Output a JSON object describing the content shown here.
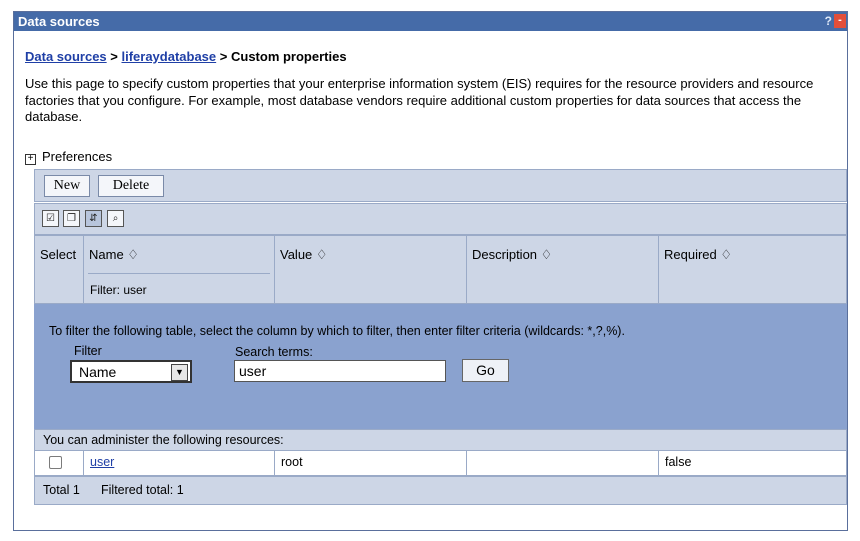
{
  "window": {
    "title": "Data sources",
    "help": "?",
    "minimize": "-"
  },
  "breadcrumb": {
    "root": "Data sources",
    "sep1": " > ",
    "db": "liferaydatabase",
    "sep2": " > ",
    "current": "Custom properties"
  },
  "intro": "Use this page to specify custom properties that your enterprise information system (EIS) requires for the resource providers and resource factories that you configure. For example, most database vendors require additional custom properties for data sources that access the database.",
  "preferences": {
    "expander": "+",
    "label": "Preferences"
  },
  "toolbar": {
    "new_label": "New",
    "delete_label": "Delete"
  },
  "icons": [
    "select-all-icon",
    "deselect-all-icon",
    "show-filter-icon",
    "clear-filter-icon"
  ],
  "table": {
    "columns": {
      "select": "Select",
      "name": "Name ♢",
      "value": "Value ♢",
      "description": "Description ♢",
      "required": "Required ♢"
    },
    "filter_hint": "Filter: user"
  },
  "filter": {
    "instruction": "To filter the following table, select the column by which to filter, then enter filter criteria (wildcards: *,?,%).",
    "filter_label": "Filter",
    "selected_column": "Name",
    "search_label": "Search terms:",
    "search_value": "user",
    "go_label": "Go"
  },
  "resources_caption": "You can administer the following resources:",
  "rows": [
    {
      "name": "user",
      "value": "root",
      "description": "",
      "required": "false"
    }
  ],
  "totals": {
    "total": "Total 1",
    "filtered": "Filtered total: 1"
  }
}
